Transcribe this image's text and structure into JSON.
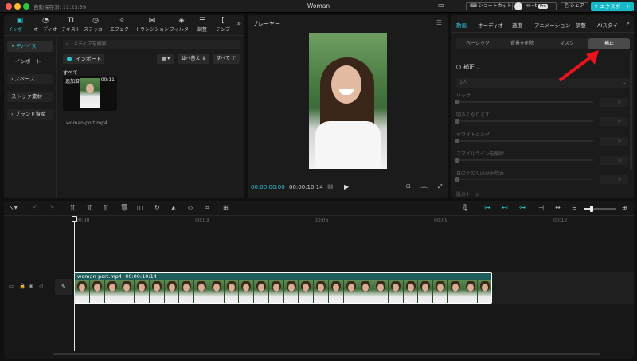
{
  "titlebar": {
    "autosave": "自動保存済: 11:23:59",
    "title": "Woman",
    "shortcut": "ショートカット",
    "user": "m···t",
    "user_badge": "Pro",
    "share": "シェア",
    "export": "エクスポート"
  },
  "media": {
    "tools": [
      {
        "label": "インポート",
        "icon": "import-icon"
      },
      {
        "label": "オーディオ",
        "icon": "audio-icon"
      },
      {
        "label": "テキスト",
        "icon": "text-icon"
      },
      {
        "label": "ステッカー",
        "icon": "sticker-icon"
      },
      {
        "label": "エフェクト",
        "icon": "effect-icon"
      },
      {
        "label": "トランジション",
        "icon": "transition-icon"
      },
      {
        "label": "フィルター",
        "icon": "filter-icon"
      },
      {
        "label": "調整",
        "icon": "adjust-icon"
      },
      {
        "label": "テンプ",
        "icon": "template-icon"
      }
    ],
    "sidebar": [
      "• デバイス",
      "インポート",
      "› スペース",
      "ストック素材",
      "› ブランド資産"
    ],
    "search_placeholder": "メディアを検索",
    "import_label": "インポート",
    "sort_label": "並べ替え",
    "filter_label": "すべて",
    "all_label": "すべて",
    "clip": {
      "tag": "追加済",
      "duration": "00:11",
      "name": "woman-port.mp4"
    }
  },
  "player": {
    "title": "プレーヤー",
    "current_time": "00:00:00:00",
    "total_time": "00:00:10:14"
  },
  "properties": {
    "tabs": [
      "動画",
      "オーディオ",
      "速度",
      "アニメーション",
      "調整",
      "AIスタイ"
    ],
    "active_tab": "動画",
    "subtabs": [
      "ベーシック",
      "背景を削除",
      "マスク",
      "補正"
    ],
    "active_subtab": "補正",
    "section": "補正",
    "dropdown": "1人",
    "sliders": [
      {
        "label": "リッサ",
        "value": "0"
      },
      {
        "label": "明るくなります",
        "value": "0"
      },
      {
        "label": "ホワイトニング",
        "value": "0"
      },
      {
        "label": "スマイルラインを削除",
        "value": "0"
      },
      {
        "label": "目の下のくぼみを除去",
        "value": "0"
      }
    ],
    "footer_label": "肌のトーン"
  },
  "timeline": {
    "ruler": [
      "00:00",
      "00:03",
      "00:06",
      "00:09",
      "00:12"
    ],
    "clip_name": "woman-port.mp4",
    "clip_duration": "00:00:10:14"
  },
  "colors": {
    "accent": "#2ec3d3",
    "clip": "#1c5c5a",
    "arrow": "#e8141c"
  }
}
